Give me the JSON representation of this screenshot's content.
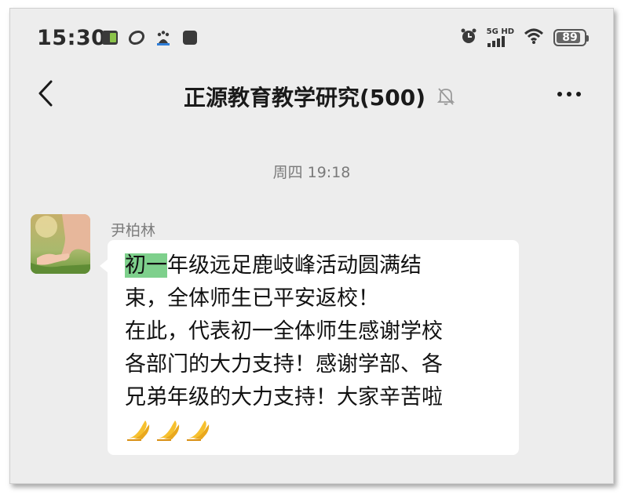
{
  "status_bar": {
    "time": "15:30",
    "network_label": "5G HD",
    "battery": "89",
    "battery_level_percent": 89
  },
  "header": {
    "title": "正源教育教学研究(500)"
  },
  "chat": {
    "timestamp": "周四 19:18",
    "message": {
      "sender": "尹柏林",
      "highlight": "初一",
      "line1_rest": "年级远足鹿岐峰活动圆满结",
      "line2": "束，全体师生已平安返校！",
      "line3": "在此，代表初一全体师生感谢学校",
      "line4": "各部门的大力支持！感谢学部、各",
      "line5": "兄弟年级的大力支持！大家辛苦啦",
      "emoji_count": 3
    }
  },
  "colors": {
    "background": "#ededed",
    "bubble": "#ffffff",
    "highlight": "#7ed08c"
  }
}
